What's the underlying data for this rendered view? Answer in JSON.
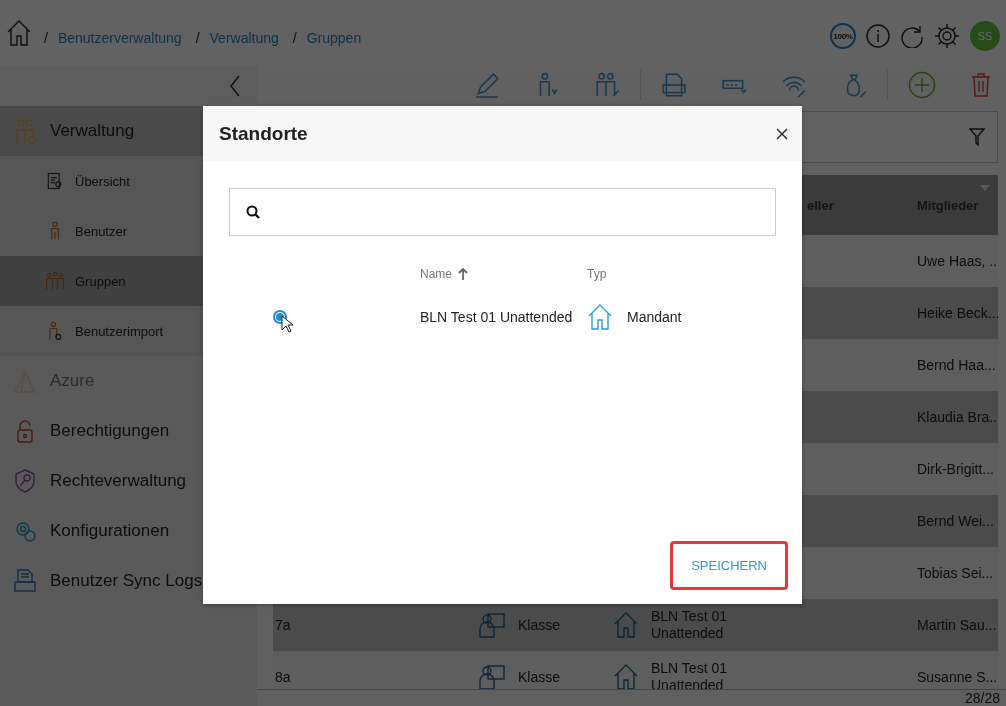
{
  "header": {
    "breadcrumb_separator": "/",
    "breadcrumbs": [
      "Benutzerverwaltung",
      "Verwaltung",
      "Gruppen"
    ],
    "zoom_badge": "100%",
    "avatar": "SS"
  },
  "sidebar": {
    "items": [
      {
        "label": "Verwaltung",
        "expanded": true,
        "disabled": false,
        "children": [
          {
            "label": "Übersicht",
            "selected": false
          },
          {
            "label": "Benutzer",
            "selected": false
          },
          {
            "label": "Gruppen",
            "selected": true
          },
          {
            "label": "Benutzerimport",
            "selected": false
          }
        ]
      },
      {
        "label": "Azure",
        "expanded": false,
        "disabled": true
      },
      {
        "label": "Berechtigungen",
        "expanded": false,
        "disabled": false
      },
      {
        "label": "Rechteverwaltung",
        "expanded": false,
        "disabled": false
      },
      {
        "label": "Konfigurationen",
        "expanded": false,
        "disabled": false
      },
      {
        "label": "Benutzer Sync Logs",
        "expanded": false,
        "disabled": false
      }
    ]
  },
  "table": {
    "columns": [
      "eller",
      "Mitglieder"
    ],
    "rows": [
      {
        "members": "Uwe Haas, ..."
      },
      {
        "members": "Heike Beck..."
      },
      {
        "members": "Bernd Haa..."
      },
      {
        "members": "Klaudia Bra..."
      },
      {
        "members": "Dirk-Brigitt..."
      },
      {
        "members": "Bernd Wei..."
      },
      {
        "members": "Tobias Sei..."
      },
      {
        "name": "7a",
        "type": "Klasse",
        "location": "BLN Test 01 Unattended",
        "members": "Martin Sau..."
      },
      {
        "name": "8a",
        "type": "Klasse",
        "location": "BLN Test 01 Unattended",
        "members": "Susanne S..."
      }
    ],
    "count": "28/28"
  },
  "dialog": {
    "title": "Standorte",
    "columns": [
      "Name",
      "Typ"
    ],
    "rows": [
      {
        "selected": true,
        "name": "BLN Test 01 Unattended",
        "type": "Mandant"
      }
    ],
    "save_button": {
      "label": "SPEICHERN",
      "highlighted": true
    }
  }
}
